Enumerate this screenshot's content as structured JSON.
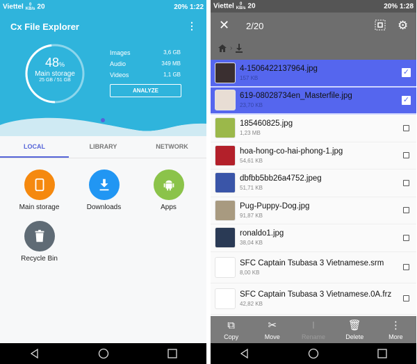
{
  "left": {
    "status": {
      "carrier": "Viettel",
      "speed": "0 KB/s",
      "notif": "20",
      "battery": "20%",
      "time": "1:22"
    },
    "title": "Cx File Explorer",
    "storage": {
      "percent": "48",
      "percent_sign": "%",
      "label": "Main storage",
      "usage": "25 GB / 51 GB",
      "fraction": 0.48
    },
    "stats": [
      {
        "label": "Images",
        "value": "3,6 GB"
      },
      {
        "label": "Audio",
        "value": "349 MB"
      },
      {
        "label": "Videos",
        "value": "1,1 GB"
      }
    ],
    "analyze": "ANALYZE",
    "tabs": [
      {
        "label": "LOCAL",
        "active": true
      },
      {
        "label": "LIBRARY"
      },
      {
        "label": "NETWORK"
      }
    ],
    "items": [
      {
        "label": "Main storage",
        "icon": "tablet-icon",
        "color": "#f5890f"
      },
      {
        "label": "Downloads",
        "icon": "download-icon",
        "color": "#2196f3"
      },
      {
        "label": "Apps",
        "icon": "android-icon",
        "color": "#8bc34a"
      },
      {
        "label": "Recycle Bin",
        "icon": "trash-icon",
        "color": "#5f6b75"
      }
    ]
  },
  "right": {
    "status": {
      "carrier": "Viettel",
      "speed": "0 KB/s",
      "notif": "20",
      "battery": "20%",
      "time": "1:28"
    },
    "count": "2/20",
    "files": [
      {
        "name": "4-1506422137964.jpg",
        "size": "157 KB",
        "selected": true,
        "thumb": "#3a2f30"
      },
      {
        "name": "619-08028734en_Masterfile.jpg",
        "size": "23,70 KB",
        "selected": true,
        "thumb": "#e8ddd4"
      },
      {
        "name": "185460825.jpg",
        "size": "1,23 MB",
        "selected": false,
        "thumb": "#9bb84a"
      },
      {
        "name": "hoa-hong-co-hai-phong-1.jpg",
        "size": "54,61 KB",
        "selected": false,
        "thumb": "#b3202a"
      },
      {
        "name": "dbfbb5bb26a4752.jpeg",
        "size": "51,71 KB",
        "selected": false,
        "thumb": "#3a55a8"
      },
      {
        "name": "Pug-Puppy-Dog.jpg",
        "size": "91,87 KB",
        "selected": false,
        "thumb": "#a89a80"
      },
      {
        "name": "ronaldo1.jpg",
        "size": "38,04 KB",
        "selected": false,
        "thumb": "#2a3a55"
      },
      {
        "name": "SFC Captain Tsubasa 3 Vietnamese.srm",
        "size": "8,00 KB",
        "selected": false,
        "thumb": "#ffffff"
      },
      {
        "name": "SFC Captain Tsubasa 3 Vietnamese.0A.frz",
        "size": "42,82 KB",
        "selected": false,
        "thumb": "#ffffff"
      }
    ],
    "actions": [
      {
        "label": "Copy",
        "icon": "copy-icon",
        "glyph": "⧉"
      },
      {
        "label": "Move",
        "icon": "scissors-icon",
        "glyph": "✂"
      },
      {
        "label": "Rename",
        "icon": "rename-icon",
        "glyph": "I",
        "disabled": true
      },
      {
        "label": "Delete",
        "icon": "trash-icon",
        "glyph": "🗑"
      },
      {
        "label": "More",
        "icon": "more-icon",
        "glyph": "⋮"
      }
    ]
  },
  "colors": {
    "accent": "#5463d8",
    "header": "#2fb4dc",
    "selection": "#5566ee"
  }
}
